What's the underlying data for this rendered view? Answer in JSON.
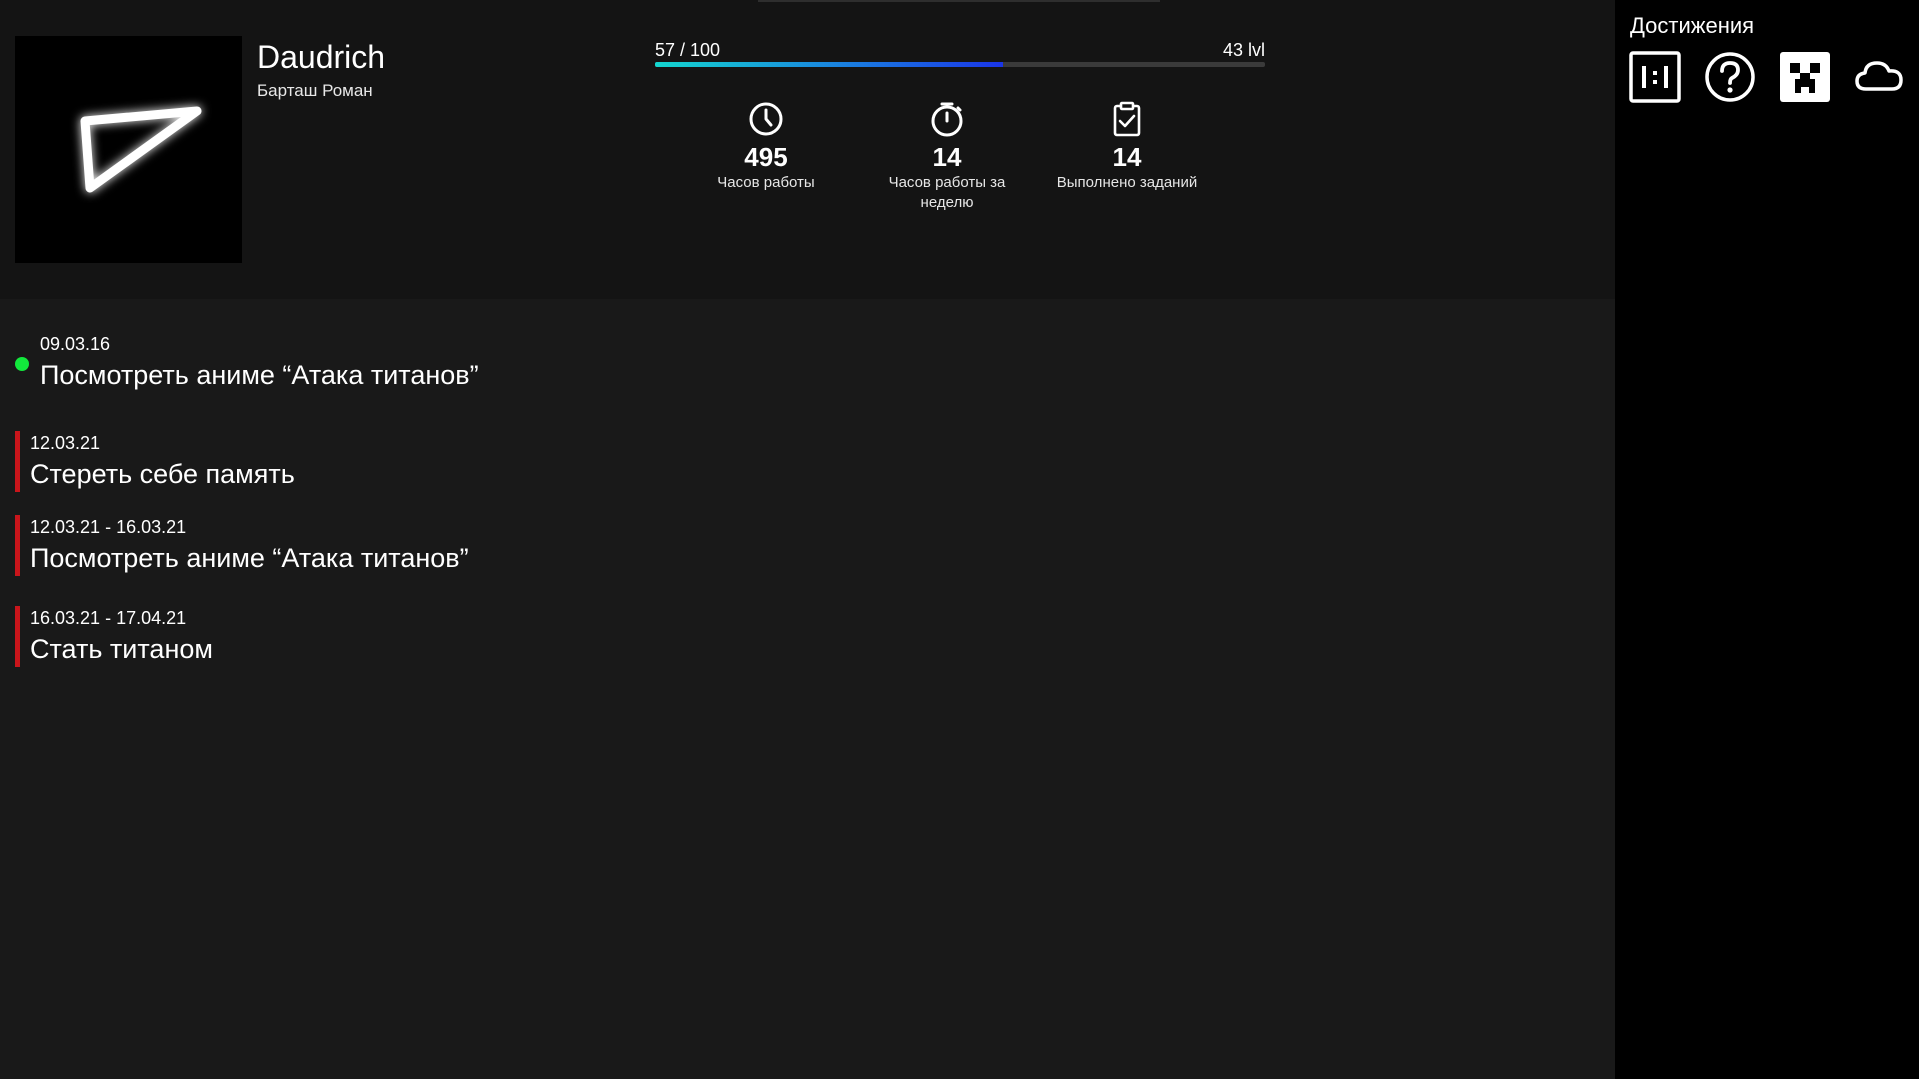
{
  "profile": {
    "nickname": "Daudrich",
    "full_name": "Барташ Роман"
  },
  "progress": {
    "text": "57 / 100",
    "current": 57,
    "max": 100,
    "level_text": "43 lvl"
  },
  "stats": [
    {
      "icon": "clock-icon",
      "value": "495",
      "label": "Часов работы"
    },
    {
      "icon": "stopwatch-icon",
      "value": "14",
      "label": "Часов работы за неделю"
    },
    {
      "icon": "clipboard-check-icon",
      "value": "14",
      "label": "Выполнено заданий"
    }
  ],
  "sidebar": {
    "title": "Достижения",
    "achievements": [
      {
        "icon": "ratio-icon"
      },
      {
        "icon": "question-icon"
      },
      {
        "icon": "creeper-icon"
      },
      {
        "icon": "cloud-icon"
      }
    ]
  },
  "current_task": {
    "date": "09.03.16",
    "title": "Посмотреть аниме “Атака титанов”",
    "status_color": "#12e83c"
  },
  "tasks": [
    {
      "date": "12.03.21",
      "title": "Стереть себе память"
    },
    {
      "date": "12.03.21 - 16.03.21",
      "title": "Посмотреть аниме “Атака титанов”"
    },
    {
      "date": "16.03.21 - 17.04.21",
      "title": "Стать титаном"
    }
  ],
  "colors": {
    "accent_red": "#c9151b",
    "progress_start": "#14d6cf",
    "progress_end": "#1a35e8"
  }
}
